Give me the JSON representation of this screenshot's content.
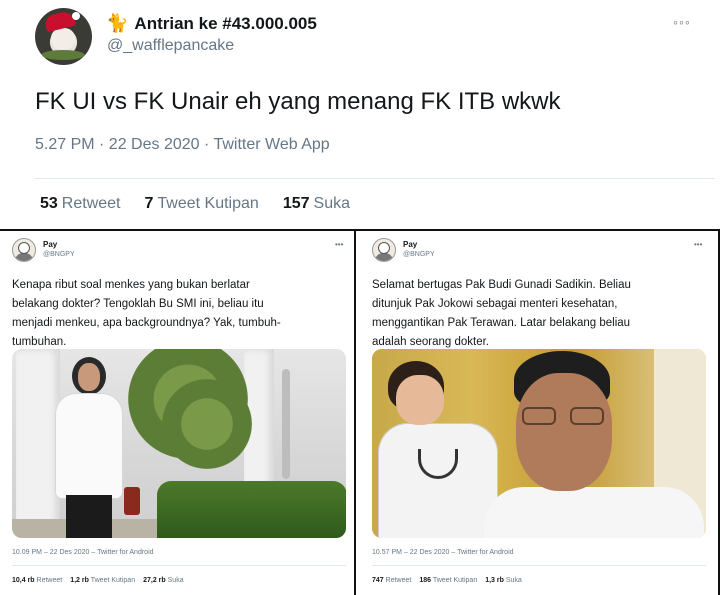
{
  "top_tweet": {
    "emoji": "🐈",
    "display_name": "Antrian ke #43.000.005",
    "handle": "@_wafflepancake",
    "more": "◦◦◦",
    "text": "FK UI vs FK Unair eh yang menang FK ITB wkwk",
    "meta": "5.27 PM · 22 Des 2020 · Twitter Web App",
    "stats": [
      {
        "count": "53",
        "label": "Retweet"
      },
      {
        "count": "7",
        "label": "Tweet Kutipan"
      },
      {
        "count": "157",
        "label": "Suka"
      }
    ]
  },
  "embedded_left": {
    "name": "Pay",
    "handle": "@BNGPY",
    "more": "•••",
    "lines": [
      "Kenapa ribut soal menkes yang bukan berlatar",
      "belakang dokter? Tengoklah Bu SMI ini, beliau itu",
      "menjadi menkeu, apa backgroundnya? Yak, tumbuh-",
      "tumbuhan."
    ],
    "meta": "10.09 PM – 22 Des 2020 – Twitter for Android",
    "stats": [
      {
        "count": "10,4 rb",
        "label": "Retweet"
      },
      {
        "count": "1,2 rb",
        "label": "Tweet Kutipan"
      },
      {
        "count": "27,2 rb",
        "label": "Suka"
      }
    ]
  },
  "embedded_right": {
    "name": "Pay",
    "handle": "@BNGPY",
    "more": "•••",
    "lines": [
      "Selamat bertugas Pak Budi Gunadi Sadikin. Beliau",
      "ditunjuk Pak Jokowi sebagai menteri kesehatan,",
      "menggantikan Pak Terawan. Latar belakang beliau",
      "adalah seorang dokter."
    ],
    "meta": "10.57 PM – 22 Des 2020 – Twitter for Android",
    "stats": [
      {
        "count": "747",
        "label": "Retweet"
      },
      {
        "count": "186",
        "label": "Tweet Kutipan"
      },
      {
        "count": "1,3 rb",
        "label": "Suka"
      }
    ]
  },
  "colors": {
    "text_primary": "#14171a",
    "text_secondary": "#657786",
    "divider": "#e1e8ed",
    "frame": "#111111"
  }
}
